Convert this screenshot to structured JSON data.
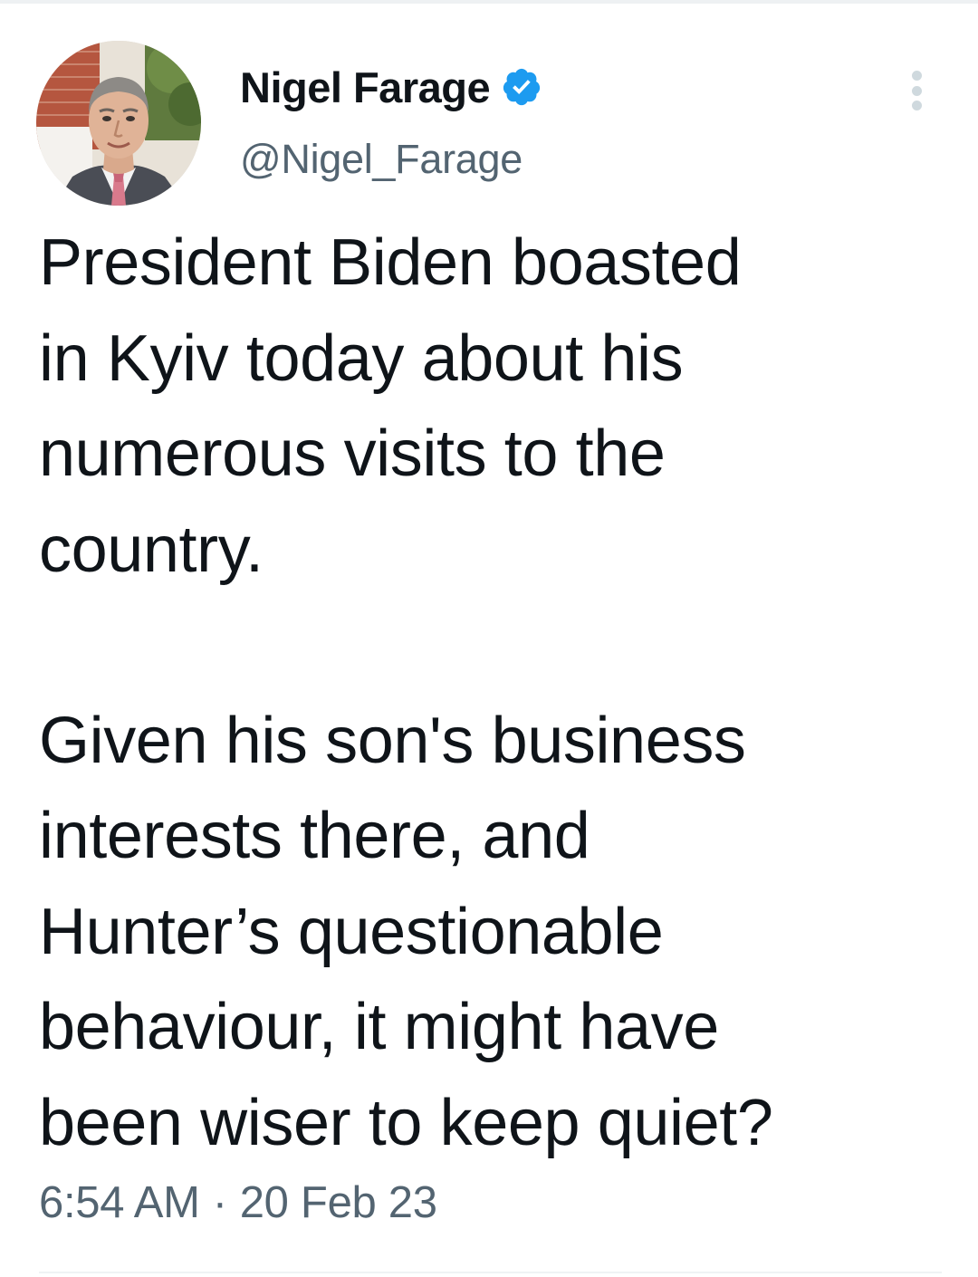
{
  "tweet": {
    "author": {
      "display_name": "Nigel Farage",
      "handle": "@Nigel_Farage",
      "verified": true,
      "verified_color": "#1d9bf0"
    },
    "text_paragraphs": [
      [
        "President Biden boasted",
        "in Kyiv today about his",
        "numerous visits to the",
        "country."
      ],
      [
        "Given his son's business",
        "interests there, and",
        "Hunter’s questionable",
        "behaviour, it might have",
        "been wiser to keep quiet?"
      ]
    ],
    "time": "6:54 AM",
    "separator": "·",
    "date": "20 Feb 23"
  },
  "icons": {
    "verified": "verified-badge-icon",
    "more": "more-options-icon"
  },
  "colors": {
    "text_primary": "#0f1419",
    "text_secondary": "#536471",
    "divider": "#eff3f4"
  }
}
